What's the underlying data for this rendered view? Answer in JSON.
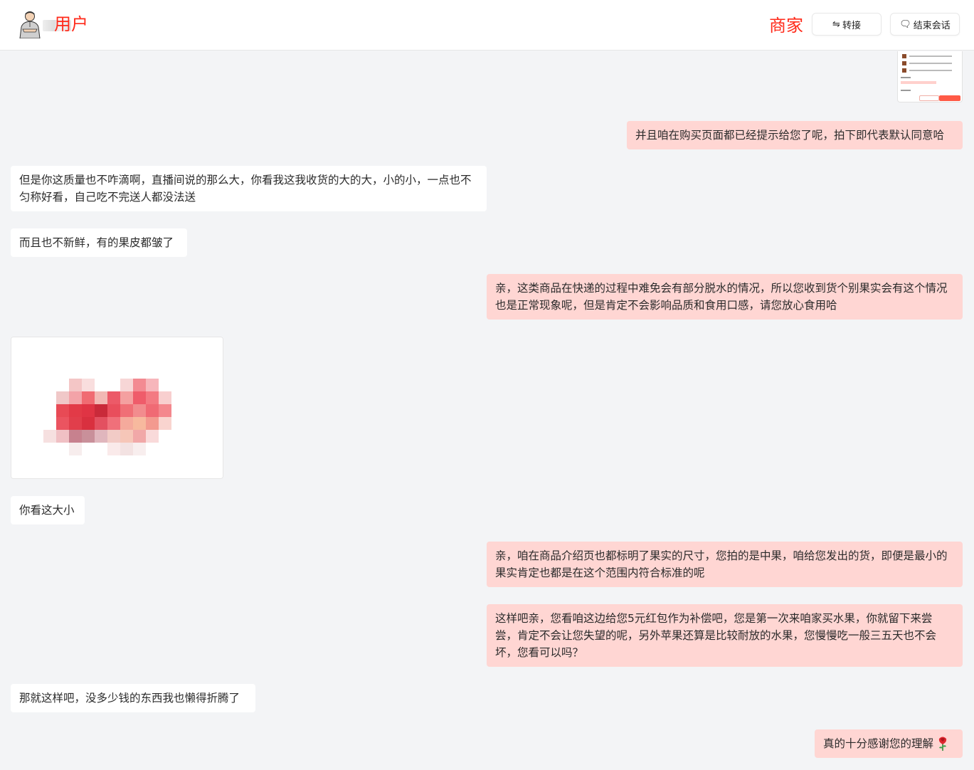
{
  "header": {
    "user_label": "用户",
    "merchant_label": "商家",
    "transfer_icon": "⇋",
    "transfer_label": "转接",
    "end_icon": "🗨",
    "end_label": "结束会话"
  },
  "messages": [
    {
      "side": "right",
      "text": "并且咱在购买页面都已经提示给您了呢，拍下即代表默认同意哈"
    },
    {
      "side": "left",
      "text": "但是你这质量也不咋滴啊，直播间说的那么大，你看我这我收货的大的大，小的小，一点也不匀称好看，自己吃不完送人都没法送"
    },
    {
      "side": "left",
      "text": "而且也不新鲜，有的果皮都皱了"
    },
    {
      "side": "right",
      "text": "亲，这类商品在快递的过程中难免会有部分脱水的情况，所以您收到货个别果实会有这个情况也是正常现象呢，但是肯定不会影响品质和食用口感，请您放心食用哈"
    },
    {
      "side": "left",
      "type": "image",
      "image": "pixelated-apple-photo"
    },
    {
      "side": "left",
      "text": "你看这大小"
    },
    {
      "side": "right",
      "text": "亲，咱在商品介绍页也都标明了果实的尺寸，您拍的是中果，咱给您发出的货，即便是最小的果实肯定也都是在这个范围内符合标准的呢"
    },
    {
      "side": "right",
      "text": "这样吧亲，您看咱这边给您5元红包作为补偿吧，您是第一次来咱家买水果，你就留下来尝尝，肯定不会让您失望的呢，另外苹果还算是比较耐放的水果，您慢慢吃一般三五天也不会坏，您看可以吗？"
    },
    {
      "side": "left",
      "text": "那就这样吧，没多少钱的东西我也懒得折腾了"
    },
    {
      "side": "right",
      "text": "真的十分感谢您的理解"
    }
  ],
  "icons": {
    "avatar": "user-avatar-icon",
    "rose": "rose-icon"
  },
  "colors": {
    "accent_red": "#ff2a1a",
    "merchant_bubble": "#ffd6d3",
    "user_bubble": "#ffffff",
    "background": "#f3f4f6"
  }
}
